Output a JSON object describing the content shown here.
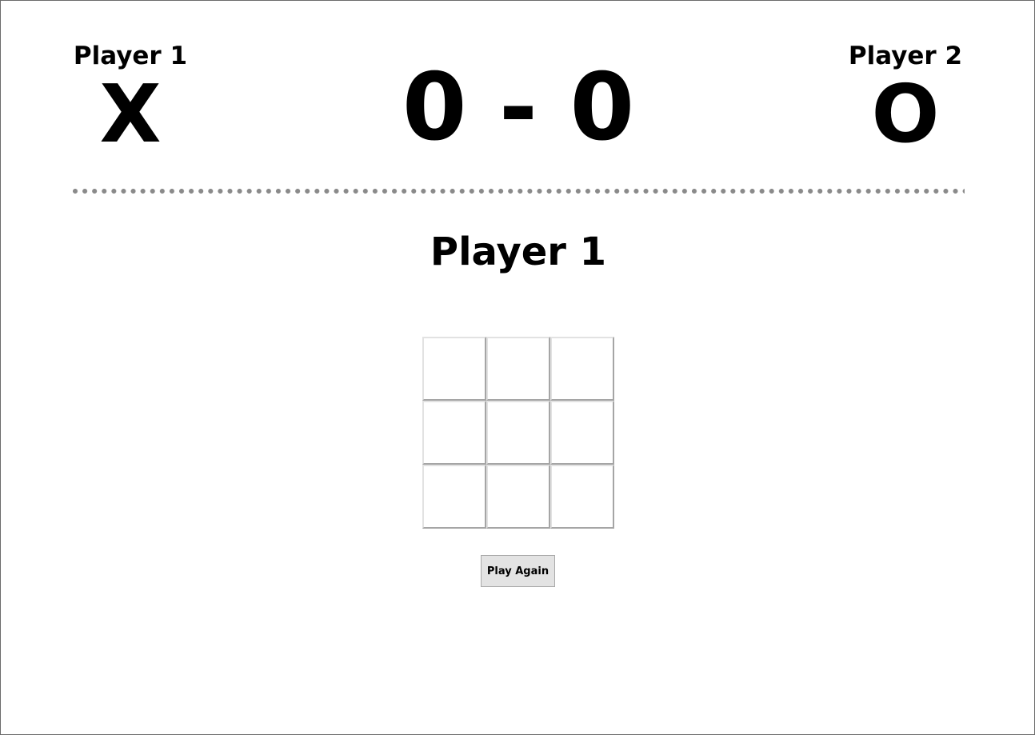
{
  "players": {
    "left": {
      "name": "Player 1",
      "symbol": "X"
    },
    "right": {
      "name": "Player 2",
      "symbol": "O"
    }
  },
  "score": {
    "text": "0 - 0",
    "player1": 0,
    "player2": 0
  },
  "turn": {
    "label": "Player 1"
  },
  "board": {
    "cells": [
      "",
      "",
      "",
      "",
      "",
      "",
      "",
      "",
      ""
    ]
  },
  "actions": {
    "play_again_label": "Play Again"
  },
  "colors": {
    "background": "#ffffff",
    "text": "#000000",
    "divider": "#8a8a8a",
    "button": "#e3e3e3"
  }
}
